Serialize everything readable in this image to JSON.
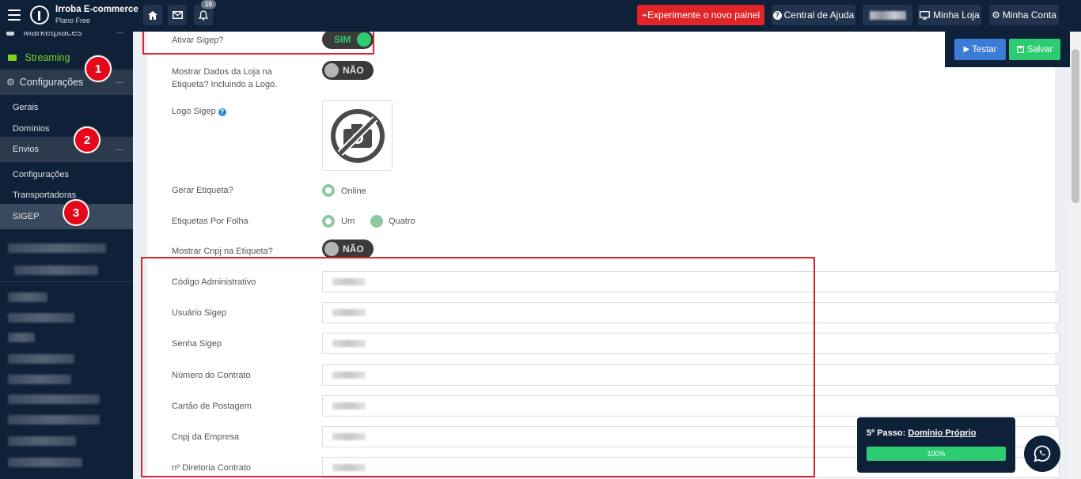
{
  "header": {
    "brand_name": "Irroba E-commerce",
    "plan": "Plano Free",
    "notification_count": "10",
    "new_panel_label": "⌁Experimente o novo painel",
    "help_label": "Central de Ajuda",
    "store_label": "Minha Loja",
    "account_label": "Minha Conta"
  },
  "sidebar": {
    "marketplaces": "Marketplaces",
    "streaming": "Streaming",
    "configuracoes": "Configurações",
    "gerais": "Gerais",
    "dominios": "Domínios",
    "envios": "Envios",
    "envios_configuracoes": "Configurações",
    "transportadoras": "Transportadoras",
    "sigep": "SIGEP",
    "markers": [
      "1",
      "2",
      "3"
    ]
  },
  "form": {
    "ativar_label": "Ativar Sigep?",
    "ativar_value": "SIM",
    "mostrar_dados_label": "Mostrar Dados da Loja na Etiqueta? Incluindo a Logo.",
    "mostrar_dados_value": "NÃO",
    "logo_label": "Logo Sigep",
    "gerar_label": "Gerar Etiqueta?",
    "gerar_option": "Online",
    "etiquetas_label": "Etiquetas Por Folha",
    "etiquetas_opt1": "Um",
    "etiquetas_opt2": "Quatro",
    "cnpj_etiqueta_label": "Mostrar Cnpj na Etiqueta?",
    "cnpj_etiqueta_value": "NÃO",
    "fields": [
      "Código Administrativo",
      "Usuário Sigep",
      "Senha Sigep",
      "Número do Contrato",
      "Cartão de Postagem",
      "Cnpj da Empresa",
      "nº Diretoria Contrato"
    ]
  },
  "actions": {
    "test_label": "Testar",
    "save_label": "Salvar"
  },
  "toast": {
    "step_prefix": "5º Passo:",
    "step_link": "Domínio Próprio",
    "progress": "100%"
  },
  "colors": {
    "navy": "#0f2138",
    "green": "#2ecc71",
    "red": "#e02427",
    "blue": "#3c7bd6"
  }
}
